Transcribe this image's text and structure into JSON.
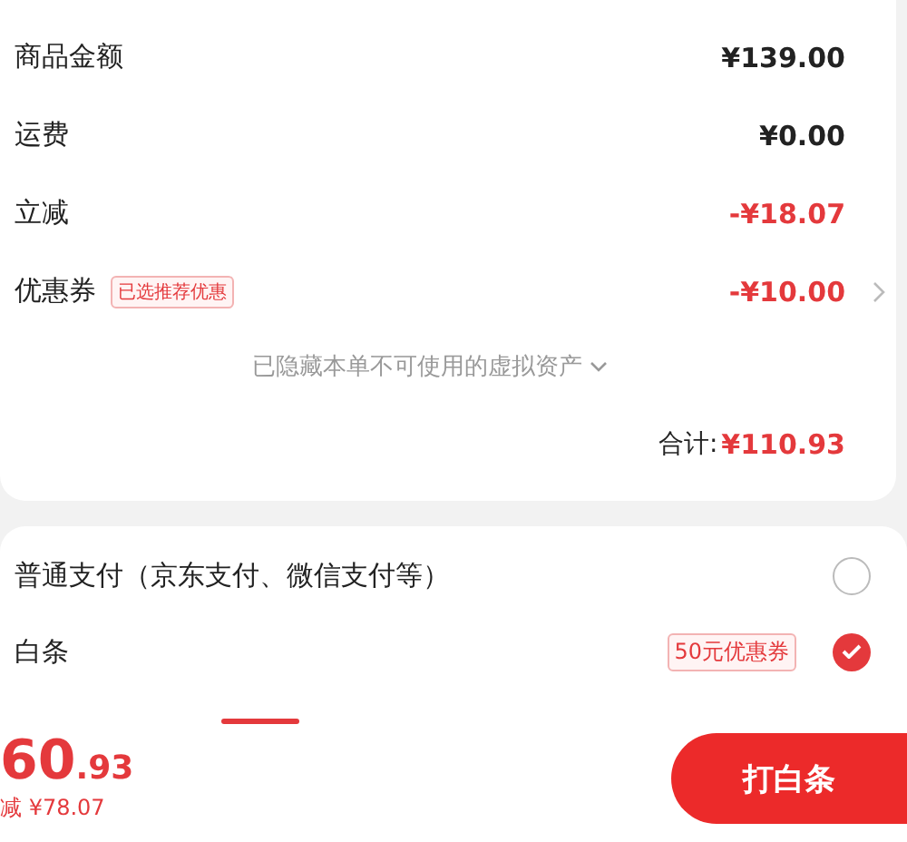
{
  "summary": {
    "rows": [
      {
        "label": "商品金额",
        "value": "¥139.00",
        "kind": "plain"
      },
      {
        "label": "运费",
        "value": "¥0.00",
        "kind": "plain"
      },
      {
        "label": "立减",
        "value": "-¥18.07",
        "kind": "discount"
      },
      {
        "label": "优惠券",
        "tag": "已选推荐优惠",
        "value": "-¥10.00",
        "kind": "coupon"
      }
    ],
    "hidden_note": "已隐藏本单不可使用的虚拟资产",
    "total_label": "合计:",
    "total_value": "¥110.93"
  },
  "payments": [
    {
      "label": "普通支付（京东支付、微信支付等）",
      "selected": false
    },
    {
      "label": "白条",
      "tag": "50元优惠券",
      "selected": true
    }
  ],
  "footer": {
    "price_integer": "60",
    "price_decimal": ".93",
    "saving": "减 ¥78.07",
    "button": "打白条"
  }
}
